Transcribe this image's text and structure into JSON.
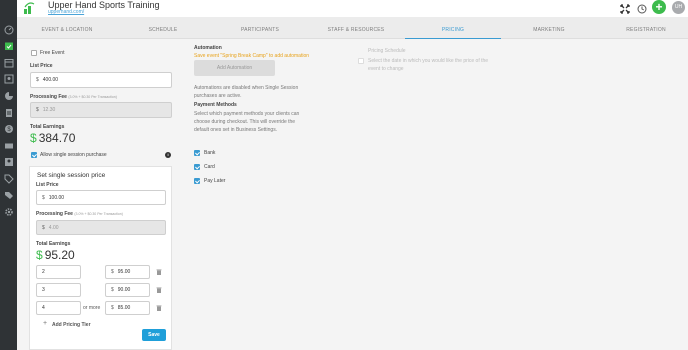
{
  "header": {
    "title": "Upper Hand Sports Training",
    "url": "upperhand.com/",
    "avatar_initials": "UH",
    "plus_label": "+"
  },
  "tabs": [
    {
      "label": "EVENT & LOCATION",
      "active": false
    },
    {
      "label": "SCHEDULE",
      "active": false
    },
    {
      "label": "PARTICIPANTS",
      "active": false
    },
    {
      "label": "STAFF & RESOURCES",
      "active": false
    },
    {
      "label": "PRICING",
      "active": true
    },
    {
      "label": "MARKETING",
      "active": false
    },
    {
      "label": "REGISTRATION",
      "active": false
    }
  ],
  "sidebar": {
    "icons": [
      "dashboard-icon",
      "calendar-check-icon",
      "calendar-icon",
      "contacts-icon",
      "chart-icon",
      "document-icon",
      "dollar-icon",
      "ticket-icon",
      "id-card-icon",
      "tag-icon",
      "tags-icon",
      "settings-icon"
    ]
  },
  "pricing": {
    "free_event_label": "Free Event",
    "list_price_label": "List Price",
    "list_price_value": "400.00",
    "processing_fee_label": "Processing Fee",
    "processing_fee_note": "(3.0% + $0.30 Per Transaction)",
    "processing_fee_value": "12.30",
    "total_earnings_label": "Total Earnings",
    "total_earnings_value": "384.70",
    "allow_single_label": "Allow single session purchase",
    "info_label": "i",
    "currency": "$"
  },
  "single_session": {
    "title": "Set single session price",
    "list_price_label": "List Price",
    "list_price_value": "100.00",
    "processing_fee_label": "Processing Fee",
    "processing_fee_note": "(3.0% + $0.30 Per Transaction)",
    "processing_fee_value": "4.00",
    "total_earnings_label": "Total Earnings",
    "total_earnings_value": "95.20",
    "tiers": [
      {
        "qty": "2",
        "price": "95.00",
        "suffix": ""
      },
      {
        "qty": "3",
        "price": "90.00",
        "suffix": ""
      },
      {
        "qty": "4",
        "price": "85.00",
        "suffix": "or more"
      }
    ],
    "add_tier_label": "Add Pricing Tier",
    "save_label": "Save"
  },
  "automation": {
    "title": "Automation",
    "warning": "Save event \"Spring Break Camp\" to add automation",
    "add_button": "Add Automation",
    "disabled_note": "Automations are disabled when Single Session purchases are active."
  },
  "payment_methods": {
    "title": "Payment Methods",
    "description": "Select which payment methods your clients can choose during checkout. This will override the default ones set in Business Settings.",
    "methods": [
      {
        "label": "Bank",
        "checked": true
      },
      {
        "label": "Card",
        "checked": true
      },
      {
        "label": "Pay Later",
        "checked": true
      }
    ]
  },
  "pricing_schedule": {
    "title": "Pricing Schedule",
    "description": "Select the date in which you would like the price of the event to change"
  },
  "colors": {
    "accent": "#3a9bd2",
    "green": "#3dbb4d",
    "warning": "#e8a21a",
    "sidebar": "#2f3336"
  }
}
